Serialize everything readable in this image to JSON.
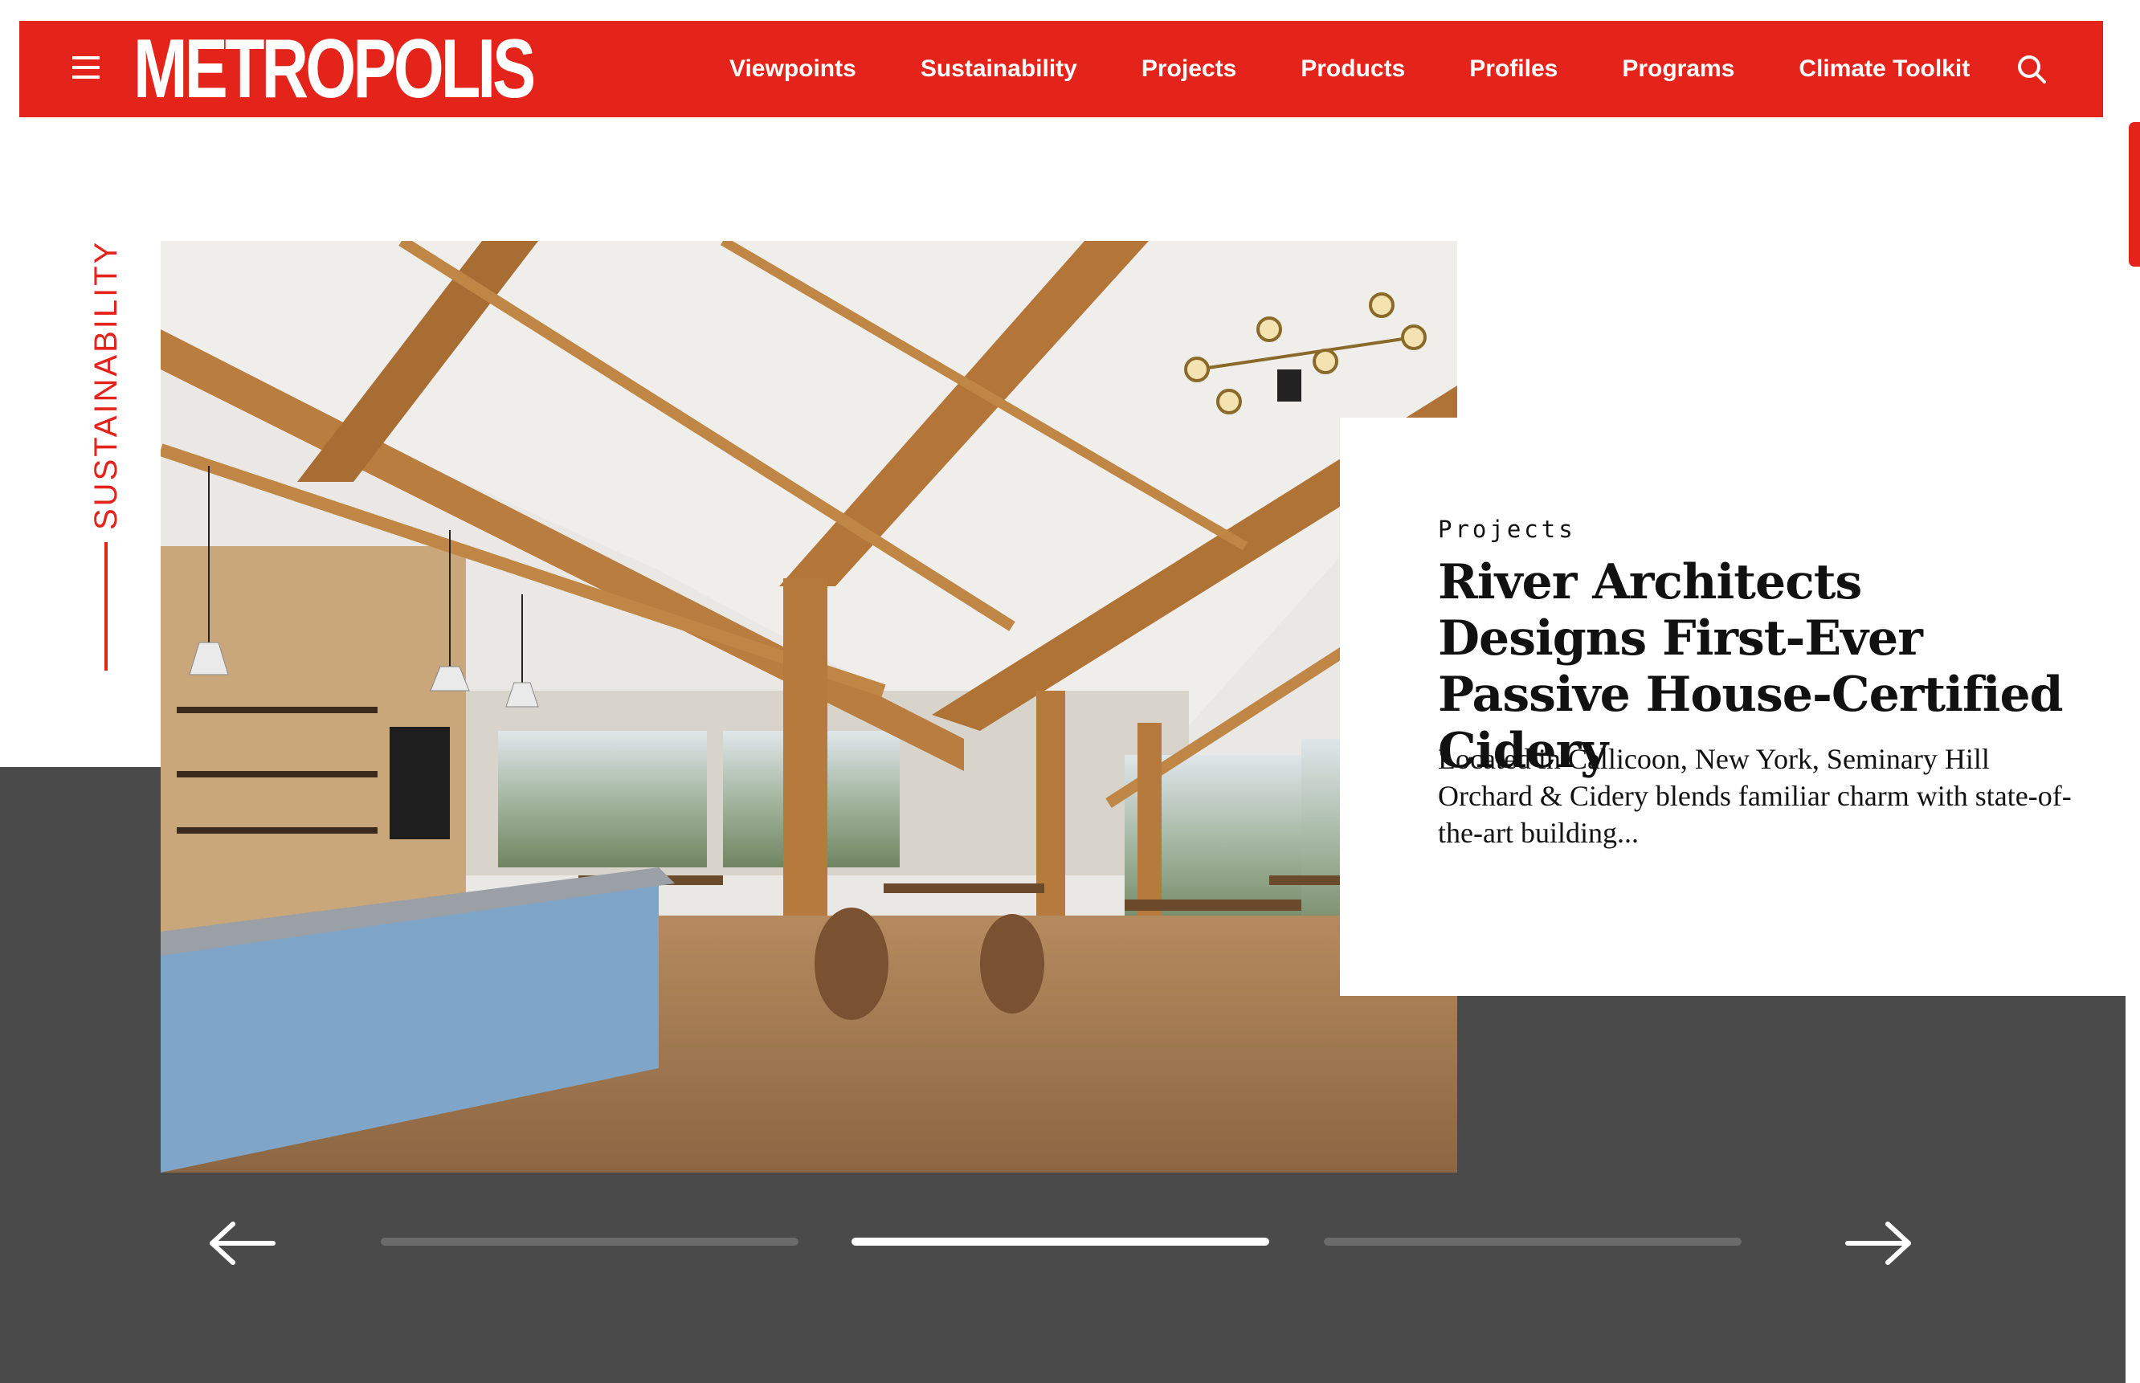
{
  "header": {
    "logo": "METROPOLIS",
    "nav": [
      "Viewpoints",
      "Sustainability",
      "Projects",
      "Products",
      "Profiles",
      "Programs",
      "Climate Toolkit"
    ]
  },
  "hero": {
    "category": "SUSTAINABILITY",
    "card": {
      "kicker": "Projects",
      "title": "River Architects Designs First-Ever Passive House-Certified Cidery",
      "excerpt": "Located in Callicoon, New York, Seminary Hill Orchard & Cidery blends familiar charm with state-of-the-art building..."
    }
  },
  "carousel": {
    "slide_count": 3,
    "active_slide": 2
  },
  "colors": {
    "brand_red": "#e4231b",
    "band_gray": "#4a4a4a"
  }
}
